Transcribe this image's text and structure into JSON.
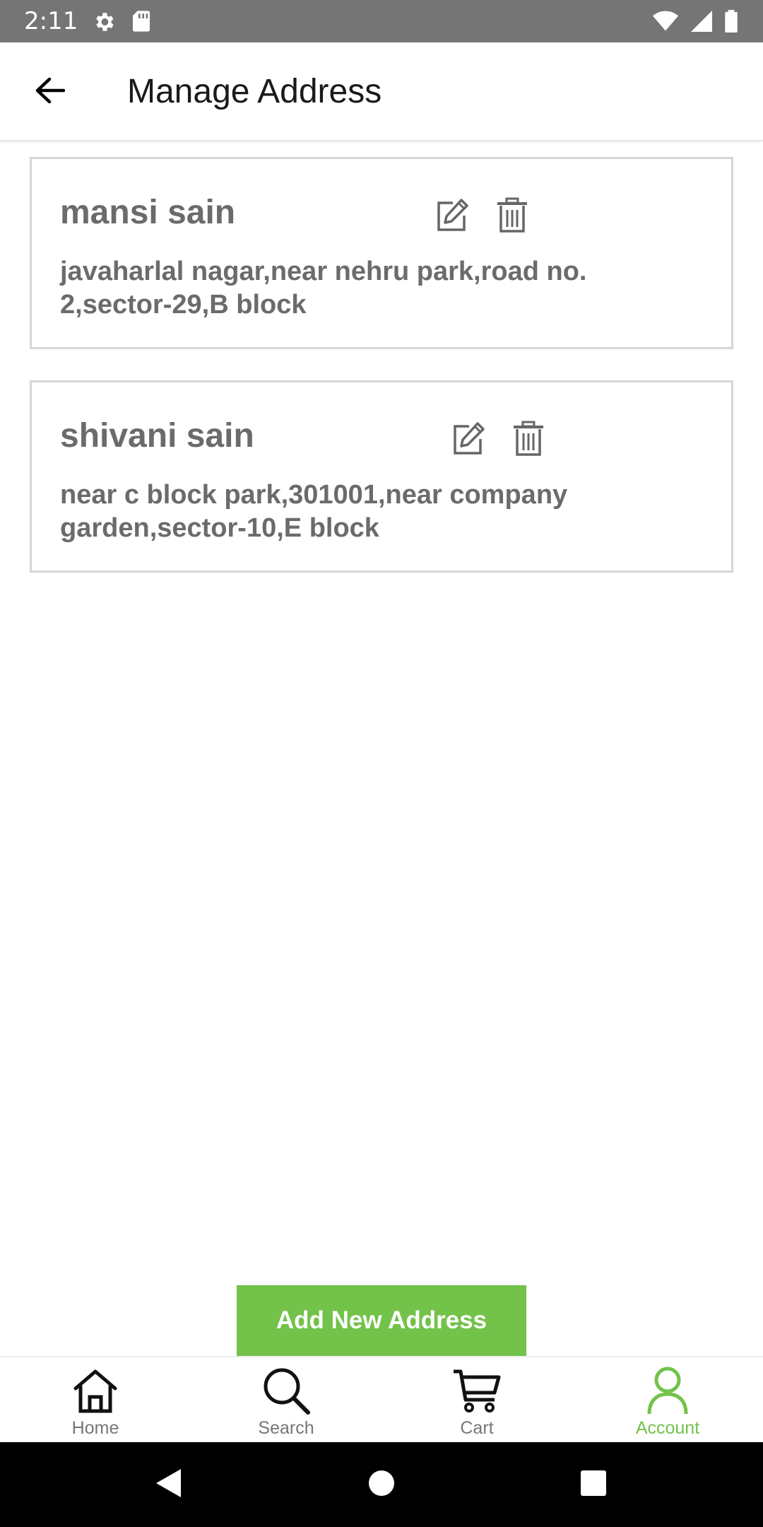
{
  "status_bar": {
    "time": "2:11",
    "left_icons": [
      "gear-icon",
      "sd-card-icon"
    ],
    "right_icons": [
      "wifi-icon",
      "signal-icon",
      "battery-icon"
    ]
  },
  "header": {
    "title": "Manage Address",
    "back_icon": "arrow-left-icon"
  },
  "addresses": [
    {
      "name": "mansi sain",
      "address": "javaharlal nagar,near nehru park,road no. 2,sector-29,B block"
    },
    {
      "name": "shivani sain",
      "address": "near c block park,301001,near company garden,sector-10,E block"
    }
  ],
  "actions": {
    "add_new_address": "Add New Address"
  },
  "bottom_nav": {
    "items": [
      {
        "label": "Home",
        "icon": "home-icon",
        "active": false
      },
      {
        "label": "Search",
        "icon": "search-icon",
        "active": false
      },
      {
        "label": "Cart",
        "icon": "cart-icon",
        "active": false
      },
      {
        "label": "Account",
        "icon": "account-icon",
        "active": true
      }
    ]
  },
  "colors": {
    "accent": "#73c24a",
    "status_bar": "#757575",
    "text_gray": "#6b6b6b",
    "card_border": "#d6d6d6"
  }
}
